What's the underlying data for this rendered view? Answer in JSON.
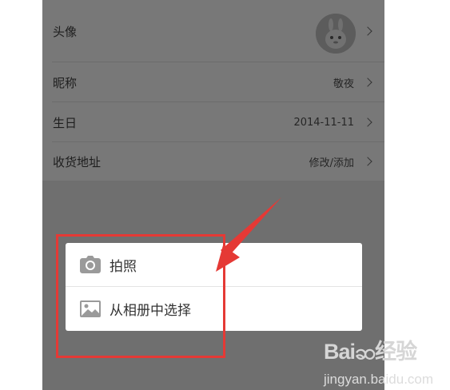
{
  "profile": {
    "rows": [
      {
        "label": "头像",
        "value": ""
      },
      {
        "label": "昵称",
        "value": "敬夜"
      },
      {
        "label": "生日",
        "value": "2014-11-11"
      },
      {
        "label": "收货地址",
        "value": "修改/添加"
      }
    ]
  },
  "photo_menu": {
    "items": [
      {
        "label": "拍照",
        "icon": "camera-icon"
      },
      {
        "label": "从相册中选择",
        "icon": "image-icon"
      }
    ]
  },
  "watermark": {
    "logo": "Baiဆ经验",
    "url": "jingyan.baidu.com"
  },
  "colors": {
    "overlay": "#6f6f6f",
    "annotation": "#e53935",
    "popup": "#ffffff"
  }
}
